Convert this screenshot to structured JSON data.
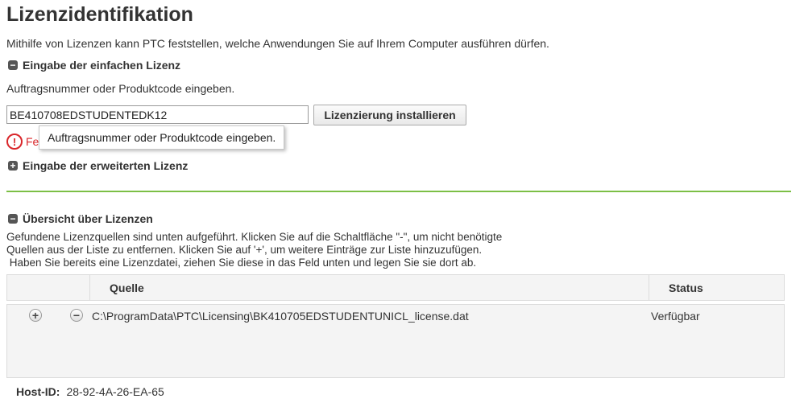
{
  "page": {
    "title": "Lizenzidentifikation",
    "description": "Mithilfe von Lizenzen kann PTC feststellen, welche Anwendungen Sie auf Ihrem Computer ausführen dürfen."
  },
  "simple_license": {
    "heading": "Eingabe der einfachen Lizenz",
    "toggle_icon": "collapse-minus-icon",
    "instruction": "Auftragsnummer oder Produktcode eingeben.",
    "input_value": "BE410708EDSTUDENTEDK12",
    "install_button": "Lizenzierung installieren",
    "error_text": "Fe",
    "error_icon": "error-exclamation-icon",
    "tooltip": "Auftragsnummer oder Produktcode eingeben."
  },
  "advanced_license": {
    "heading": "Eingabe der erweiterten Lizenz",
    "toggle_icon": "expand-plus-icon"
  },
  "overview": {
    "heading": "Übersicht über Lizenzen",
    "text_line1": "Gefundene Lizenzquellen sind unten aufgeführt. Klicken Sie auf die Schaltfläche \"-\", um nicht benötigte",
    "text_line2": "Quellen aus der Liste zu entfernen. Klicken Sie auf '+', um weitere Einträge zur Liste hinzuzufügen.",
    "text_line3": " Haben Sie bereits eine Lizenzdatei, ziehen Sie diese in das Feld unten und legen Sie sie dort ab.",
    "columns": {
      "source": "Quelle",
      "status": "Status"
    },
    "rows": [
      {
        "path": "C:\\ProgramData\\PTC\\Licensing\\BK410705EDSTUDENTUNICL_license.dat",
        "status": "Verfügbar",
        "add": "+",
        "remove": "−"
      }
    ]
  },
  "host": {
    "label": "Host-ID:",
    "value": "28-92-4A-26-EA-65"
  },
  "colors": {
    "divider": "#7cbf45",
    "error": "#d9262a"
  }
}
